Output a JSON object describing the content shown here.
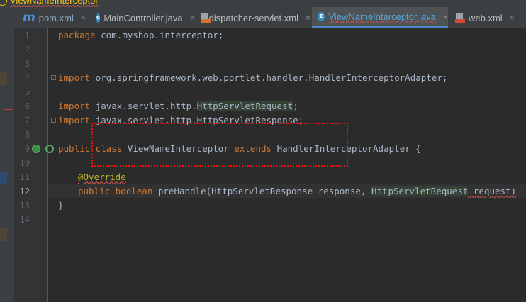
{
  "breadcrumb": {
    "text": "ViewNameInterceptor"
  },
  "tabs": [
    {
      "label": "pom.xml",
      "icon": "maven-icon",
      "active": false
    },
    {
      "label": "MainController.java",
      "icon": "java-class-icon",
      "active": false
    },
    {
      "label": "dispatcher-servlet.xml",
      "icon": "xml-file-icon",
      "active": false
    },
    {
      "label": "ViewNameInterceptor.java",
      "icon": "java-class-icon",
      "active": true
    },
    {
      "label": "web.xml",
      "icon": "web-xml-icon",
      "active": false
    }
  ],
  "tab_close": "×",
  "icon_m": "m",
  "icon_c": "c",
  "line_numbers": [
    "1",
    "2",
    "3",
    "4",
    "5",
    "6",
    "7",
    "8",
    "9",
    "10",
    "11",
    "12",
    "13",
    "14"
  ],
  "code": {
    "l1_kw": "package",
    "l1_rest": " com.myshop.interceptor;",
    "l4_kw": "import",
    "l4_rest": " org.springframework.web.portlet.handler.HandlerInterceptorAdapter;",
    "l6_kw": "import",
    "l6_pkg": " javax.servlet.http.",
    "l6_cls": "HttpServletRequest",
    "l6_end": ";",
    "l7_kw": "import",
    "l7_pkg": " javax.servlet.http.",
    "l7_cls": "HttpServletResponse",
    "l7_end": ";",
    "l9_kw1": "public class",
    "l9_name": " ViewNameInterceptor ",
    "l9_kw2": "extends",
    "l9_rest": " HandlerInterceptorAdapter {",
    "l11_ann": "@Override",
    "l12_kw": "public boolean",
    "l12_meth": " preHandle",
    "l12_a": "(HttpServletResponse response, ",
    "l12_b1": "Htt",
    "l12_b2": "pServletRequest",
    "l12_c": " request)",
    "l13": "}"
  },
  "colors": {
    "keyword": "#cc7832",
    "annotation": "#bbb529",
    "text": "#a9b7c6",
    "accent": "#4a88c7"
  }
}
